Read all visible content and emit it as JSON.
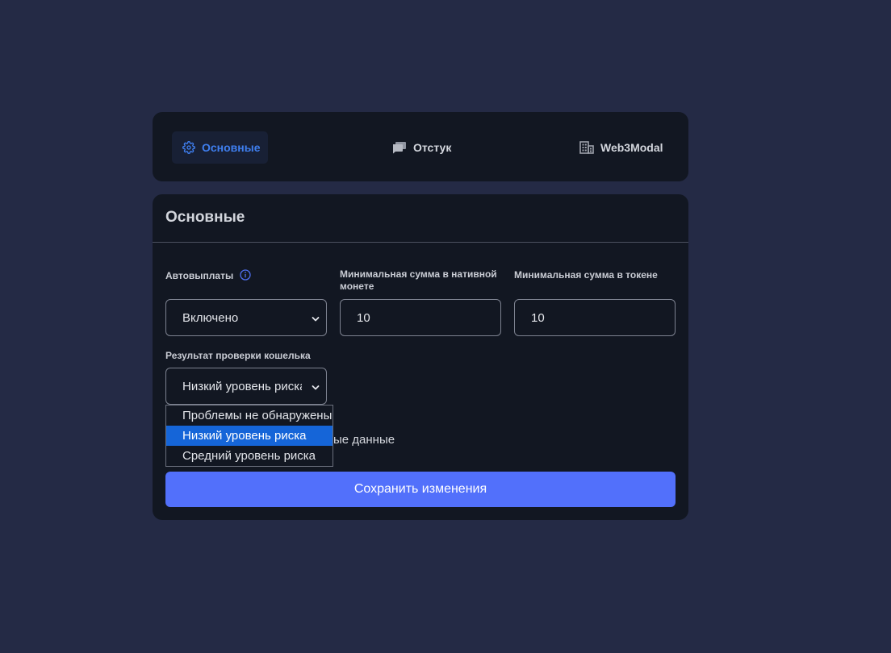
{
  "tabs": [
    {
      "label": "Основные",
      "icon": "gear-icon",
      "active": true
    },
    {
      "label": "Отстук",
      "icon": "chat-bubbles-icon",
      "active": false
    },
    {
      "label": "Web3Modal",
      "icon": "building-icon",
      "active": false
    }
  ],
  "card": {
    "title": "Основные"
  },
  "fields": {
    "autopay": {
      "label": "Автовыплаты",
      "value": "Включено"
    },
    "min_native": {
      "label": "Минимальная сумма в нативной монете",
      "value": "10"
    },
    "min_token": {
      "label": "Минимальная сумма в токене",
      "value": "10"
    },
    "wallet_check": {
      "label": "Результат проверки кошелька",
      "value": "Низкий уровень риска"
    }
  },
  "dropdown": {
    "options": [
      "Проблемы не обнаружены",
      "Низкий уровень риска",
      "Средний уровень риска"
    ],
    "selected_index": 1
  },
  "partially_hidden_text": "ые данные",
  "save_label": "Сохранить изменения",
  "colors": {
    "accent": "#5270fb",
    "active_tab": "#3f7ff0",
    "selected_option": "#1565d8"
  }
}
